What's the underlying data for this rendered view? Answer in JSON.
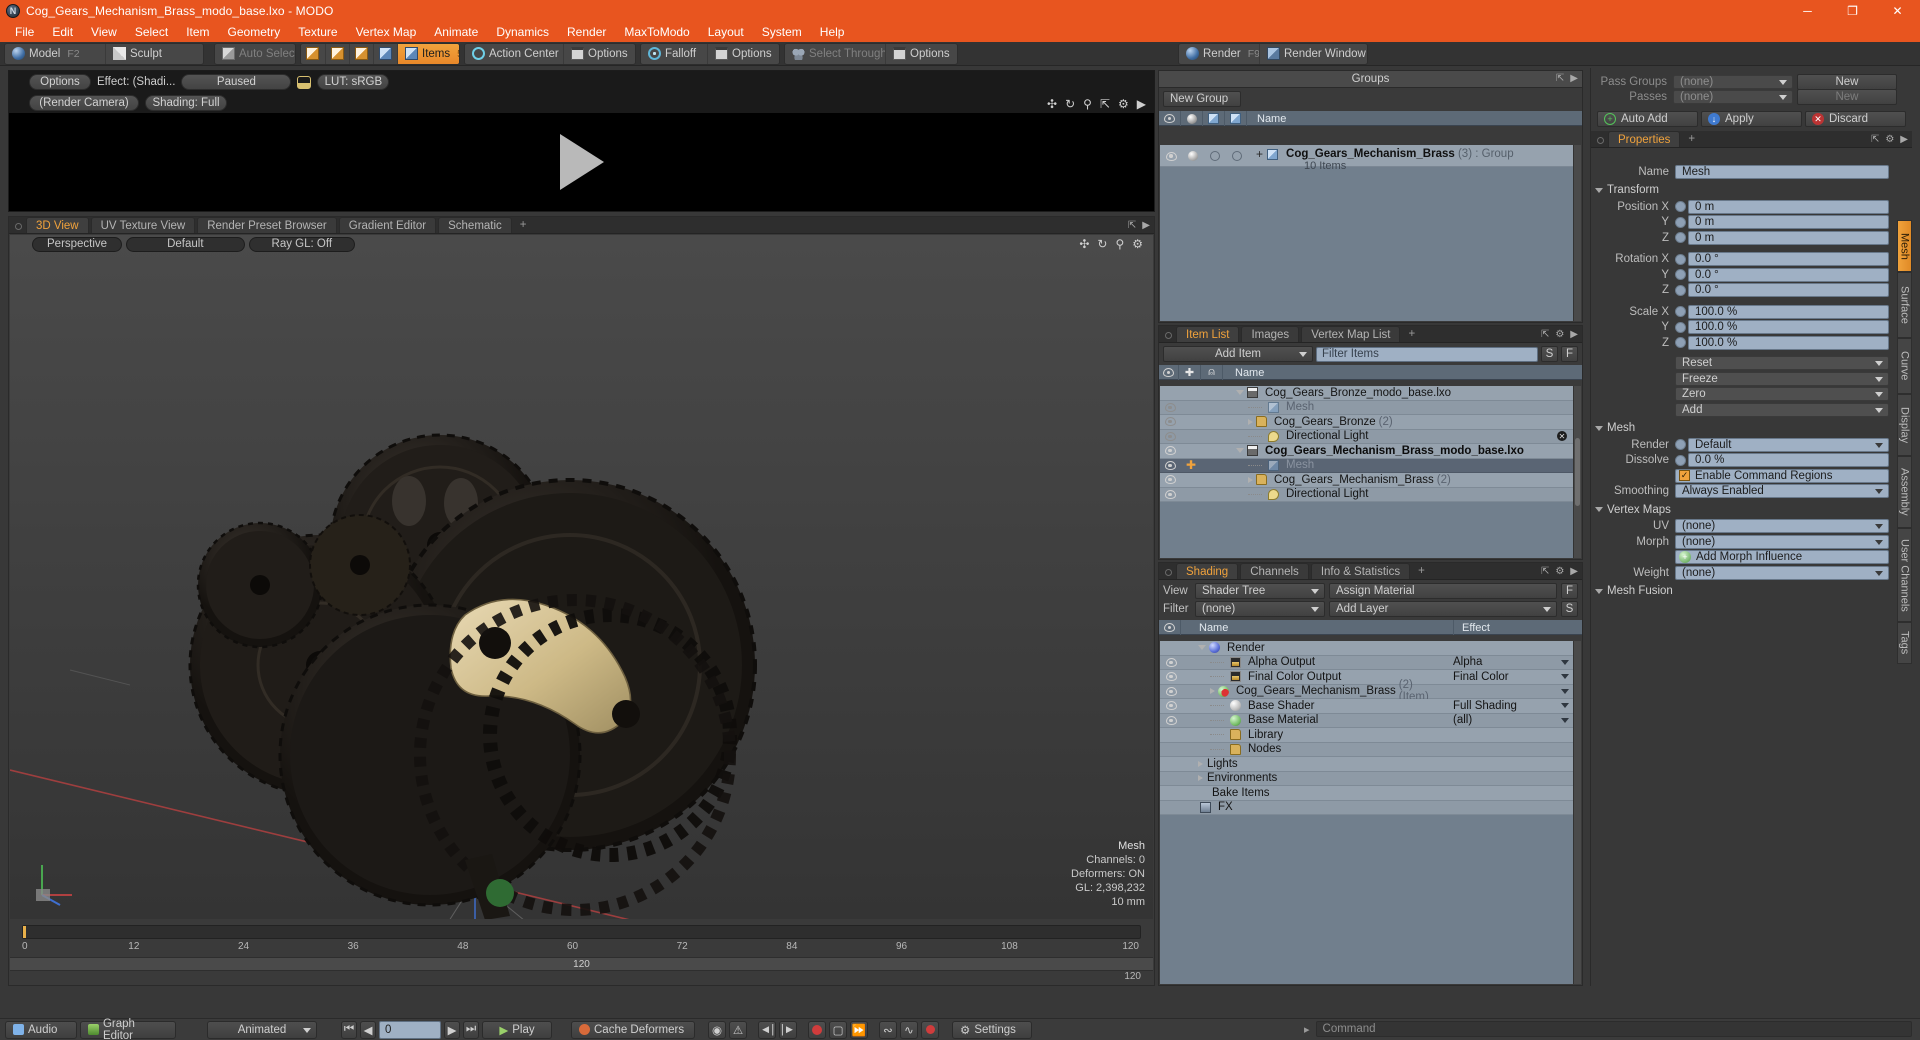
{
  "window": {
    "title": "Cog_Gears_Mechanism_Brass_modo_base.lxo - MODO",
    "app_icon": "modo-icon",
    "minimize": "─",
    "maximize": "❐",
    "close": "✕"
  },
  "menu": {
    "items": [
      "File",
      "Edit",
      "View",
      "Select",
      "Item",
      "Geometry",
      "Texture",
      "Vertex Map",
      "Animate",
      "Dynamics",
      "Render",
      "MaxToModo",
      "Layout",
      "System",
      "Help"
    ]
  },
  "toolbar": {
    "mode_model": "Model",
    "mode_model_key": "F2",
    "mode_sculpt": "Sculpt",
    "auto_select": "Auto Select",
    "items": "Items",
    "items_key": "5",
    "action_center": "Action Center",
    "options_1": "Options",
    "falloff": "Falloff",
    "options_2": "Options",
    "select_through": "Select Through",
    "options_3": "Options",
    "render": "Render",
    "render_key": "F9",
    "render_window": "Render Window"
  },
  "preview": {
    "options": "Options",
    "effect": "Effect: (Shadi...",
    "paused": "Paused",
    "lock_icon": "unlock-icon",
    "lut": "LUT: sRGB",
    "render_camera": "(Render Camera)",
    "shading": "Shading: Full",
    "play_icon": "play-icon"
  },
  "viewport": {
    "tabs": [
      {
        "label": "3D View",
        "active": true
      },
      {
        "label": "UV Texture View",
        "active": false
      },
      {
        "label": "Render Preset Browser",
        "active": false
      },
      {
        "label": "Gradient Editor",
        "active": false
      },
      {
        "label": "Schematic",
        "active": false
      },
      {
        "label": "+",
        "active": false
      }
    ],
    "controls": [
      "Perspective",
      "Default",
      "Ray GL: Off"
    ],
    "status": {
      "title": "Mesh",
      "channels": "Channels: 0",
      "deformers": "Deformers: ON",
      "gl": "GL: 2,398,232",
      "scale": "10 mm"
    },
    "icons": [
      "move-icon",
      "rotate-icon",
      "zoom-icon",
      "fit-icon",
      "gear-icon"
    ]
  },
  "timeline": {
    "labels": [
      "0",
      "12",
      "24",
      "36",
      "48",
      "60",
      "72",
      "84",
      "96",
      "108",
      "120"
    ],
    "range_end": "120",
    "total": "120"
  },
  "groups_panel": {
    "title": "Groups",
    "new_group_button": "New Group",
    "columns": [
      "eye-col",
      "shade-col",
      "cube-col",
      "cube2-col",
      "Name"
    ],
    "rows": [
      {
        "name": "Cog_Gears_Mechanism_Brass",
        "count": "(3)",
        "suffix": ": Group",
        "sub": "10 Items",
        "icon": "group-icon",
        "expand": "+"
      }
    ]
  },
  "item_list": {
    "tabs": [
      {
        "label": "Item List",
        "active": true
      },
      {
        "label": "Images",
        "active": false
      },
      {
        "label": "Vertex Map List",
        "active": false
      },
      {
        "label": "+",
        "active": false
      }
    ],
    "add_item": "Add Item",
    "filter_placeholder": "Filter Items",
    "filter_value": "Filter Items",
    "btn_s": "S",
    "btn_f": "F",
    "columns": [
      "eye-col",
      "lock-col",
      "axis-col",
      "Name"
    ],
    "rows": [
      {
        "indent": 0,
        "label": "Cog_Gears_Bronze_modo_base.lxo",
        "icon": "clapper-icon",
        "twirl": "open",
        "eye": false,
        "bold": false,
        "dim": false
      },
      {
        "indent": 1,
        "label": "Mesh",
        "icon": "mesh-icon",
        "twirl": "none",
        "eye": true,
        "bold": false,
        "dim": true
      },
      {
        "indent": 1,
        "label": "Cog_Gears_Bronze",
        "count": "(2)",
        "icon": "folder-icon",
        "twirl": "closed",
        "eye": true,
        "bold": false,
        "dim": false
      },
      {
        "indent": 1,
        "label": "Directional Light",
        "icon": "light-icon",
        "twirl": "none",
        "eye": true,
        "bold": false,
        "dim": false,
        "badge": "x"
      },
      {
        "indent": 0,
        "label": "Cog_Gears_Mechanism_Brass_modo_base.lxo",
        "icon": "clapper-icon",
        "twirl": "open",
        "eye": true,
        "bold": true,
        "dim": false
      },
      {
        "indent": 1,
        "label": "Mesh",
        "icon": "mesh-icon",
        "twirl": "none",
        "eye": true,
        "bold": false,
        "dim": true,
        "selected": true,
        "lock": true
      },
      {
        "indent": 1,
        "label": "Cog_Gears_Mechanism_Brass",
        "count": "(2)",
        "icon": "folder-icon",
        "twirl": "closed",
        "eye": true,
        "bold": false,
        "dim": false
      },
      {
        "indent": 1,
        "label": "Directional Light",
        "icon": "light-icon",
        "twirl": "none",
        "eye": true,
        "bold": false,
        "dim": false
      }
    ]
  },
  "shading_panel": {
    "tabs": [
      {
        "label": "Shading",
        "active": true
      },
      {
        "label": "Channels",
        "active": false
      },
      {
        "label": "Info & Statistics",
        "active": false
      },
      {
        "label": "+",
        "active": false
      }
    ],
    "view_label": "View",
    "view_value": "Shader Tree",
    "assign_material": "Assign Material",
    "filter_label": "Filter",
    "filter_value": "(none)",
    "add_layer": "Add Layer",
    "btn_f": "F",
    "btn_s": "S",
    "columns": [
      "eye-col",
      "Name",
      "Effect"
    ],
    "rows": [
      {
        "indent": 0,
        "label": "Render",
        "icon": "blue-sphere-icon",
        "twirl": "open",
        "effect": "",
        "eye": false
      },
      {
        "indent": 1,
        "label": "Alpha Output",
        "icon": "image-icon",
        "twirl": "none",
        "effect": "Alpha",
        "eye": true,
        "has_dropdown": true
      },
      {
        "indent": 1,
        "label": "Final Color Output",
        "icon": "image-icon",
        "twirl": "none",
        "effect": "Final Color",
        "eye": true,
        "has_dropdown": true
      },
      {
        "indent": 1,
        "label": "Cog_Gears_Mechanism_Brass",
        "count": "(2) (Item)",
        "icon": "material-icon",
        "twirl": "closed",
        "effect": "",
        "eye": true,
        "has_dropdown": true
      },
      {
        "indent": 1,
        "label": "Base Shader",
        "icon": "white-sphere-icon",
        "twirl": "none",
        "effect": "Full Shading",
        "eye": true,
        "has_dropdown": true
      },
      {
        "indent": 1,
        "label": "Base Material",
        "icon": "green-sphere-icon",
        "twirl": "none",
        "effect": "(all)",
        "eye": true,
        "has_dropdown": true
      },
      {
        "indent": 1,
        "label": "Library",
        "icon": "folder-icon",
        "twirl": "none",
        "effect": "",
        "eye": false
      },
      {
        "indent": 1,
        "label": "Nodes",
        "icon": "folder-icon",
        "twirl": "none",
        "effect": "",
        "eye": false
      },
      {
        "indent": 0,
        "label": "Lights",
        "icon": "none",
        "twirl": "closed",
        "effect": "",
        "eye": false
      },
      {
        "indent": 0,
        "label": "Environments",
        "icon": "none",
        "twirl": "closed",
        "effect": "",
        "eye": false
      },
      {
        "indent": 0,
        "label": "Bake Items",
        "icon": "none",
        "twirl": "none",
        "effect": "",
        "eye": false
      },
      {
        "indent": 0,
        "label": "FX",
        "icon": "fx-icon",
        "twirl": "none",
        "effect": "",
        "eye": false
      }
    ]
  },
  "passes": {
    "pass_groups_label": "Pass Groups",
    "pass_groups_value": "(none)",
    "pass_groups_new": "New",
    "passes_label": "Passes",
    "passes_value": "(none)",
    "passes_new": "New",
    "auto_add": "Auto Add",
    "apply": "Apply",
    "discard": "Discard"
  },
  "properties": {
    "tab": "Properties",
    "tab_plus": "+",
    "name_label": "Name",
    "name_value": "Mesh",
    "transform_section": "Transform",
    "transform_rows": [
      {
        "label": "Position X",
        "value": "0 m"
      },
      {
        "label": "Y",
        "value": "0 m"
      },
      {
        "label": "Z",
        "value": "0 m"
      },
      {
        "label": "Rotation X",
        "value": "0.0 °"
      },
      {
        "label": "Y",
        "value": "0.0 °"
      },
      {
        "label": "Z",
        "value": "0.0 °"
      },
      {
        "label": "Scale X",
        "value": "100.0 %"
      },
      {
        "label": "Y",
        "value": "100.0 %"
      },
      {
        "label": "Z",
        "value": "100.0 %"
      }
    ],
    "transform_menus": [
      "Reset",
      "Freeze",
      "Zero",
      "Add"
    ],
    "mesh_section": "Mesh",
    "render_label": "Render",
    "render_value": "Default",
    "dissolve_label": "Dissolve",
    "dissolve_value": "0.0 %",
    "enable_command_regions": "Enable Command Regions",
    "enable_command_regions_checked": true,
    "smoothing_label": "Smoothing",
    "smoothing_value": "Always Enabled",
    "vertex_maps_section": "Vertex Maps",
    "uv_label": "UV",
    "uv_value": "(none)",
    "morph_label": "Morph",
    "morph_value": "(none)",
    "add_morph_influence": "Add Morph Influence",
    "weight_label": "Weight",
    "weight_value": "(none)",
    "mesh_fusion_section": "Mesh Fusion",
    "side_tabs": [
      "Mesh",
      "Surface",
      "Curve",
      "Display",
      "Assembly",
      "User Channels",
      "Tags"
    ]
  },
  "bottom_bar": {
    "audio": "Audio",
    "graph_editor": "Graph Editor",
    "animated": "Animated",
    "frame_value": "0",
    "play": "Play",
    "cache_deformers": "Cache Deformers",
    "settings": "Settings",
    "command_placeholder": "Command"
  },
  "colors": {
    "accent": "#e8551f",
    "highlight": "#f0a23c",
    "panel": "#3a3a3a",
    "header": "#5d6a77",
    "field": "#9fb0c4"
  }
}
